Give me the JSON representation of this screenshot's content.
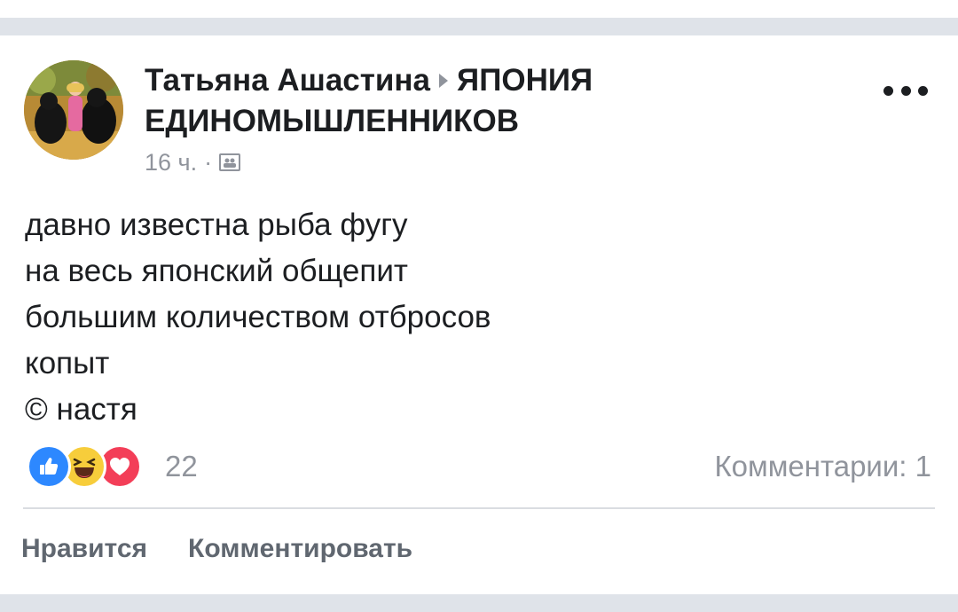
{
  "post": {
    "author": "Татьяна Ашастина",
    "group": "ЯПОНИЯ ЕДИНОМЫШЛЕННИКОВ",
    "time": "16 ч.",
    "separator": "·",
    "privacy_icon": "group-icon",
    "menu_icon": "more-options-icon",
    "text_lines": [
      "давно известна рыба фугу",
      "на весь японский общепит",
      "большим количеством отбросов",
      "копыт",
      "© настя"
    ]
  },
  "reactions": {
    "icons": [
      "like-icon",
      "haha-icon",
      "love-icon"
    ],
    "count": "22",
    "comments": "Комментарии: 1"
  },
  "actions": {
    "like": "Нравится",
    "comment": "Комментировать"
  },
  "colors": {
    "like": "#2d88ff",
    "haha": "#f7cd3b",
    "love": "#f33e58",
    "separator": "#dfe3e9",
    "meta": "#90949c"
  }
}
